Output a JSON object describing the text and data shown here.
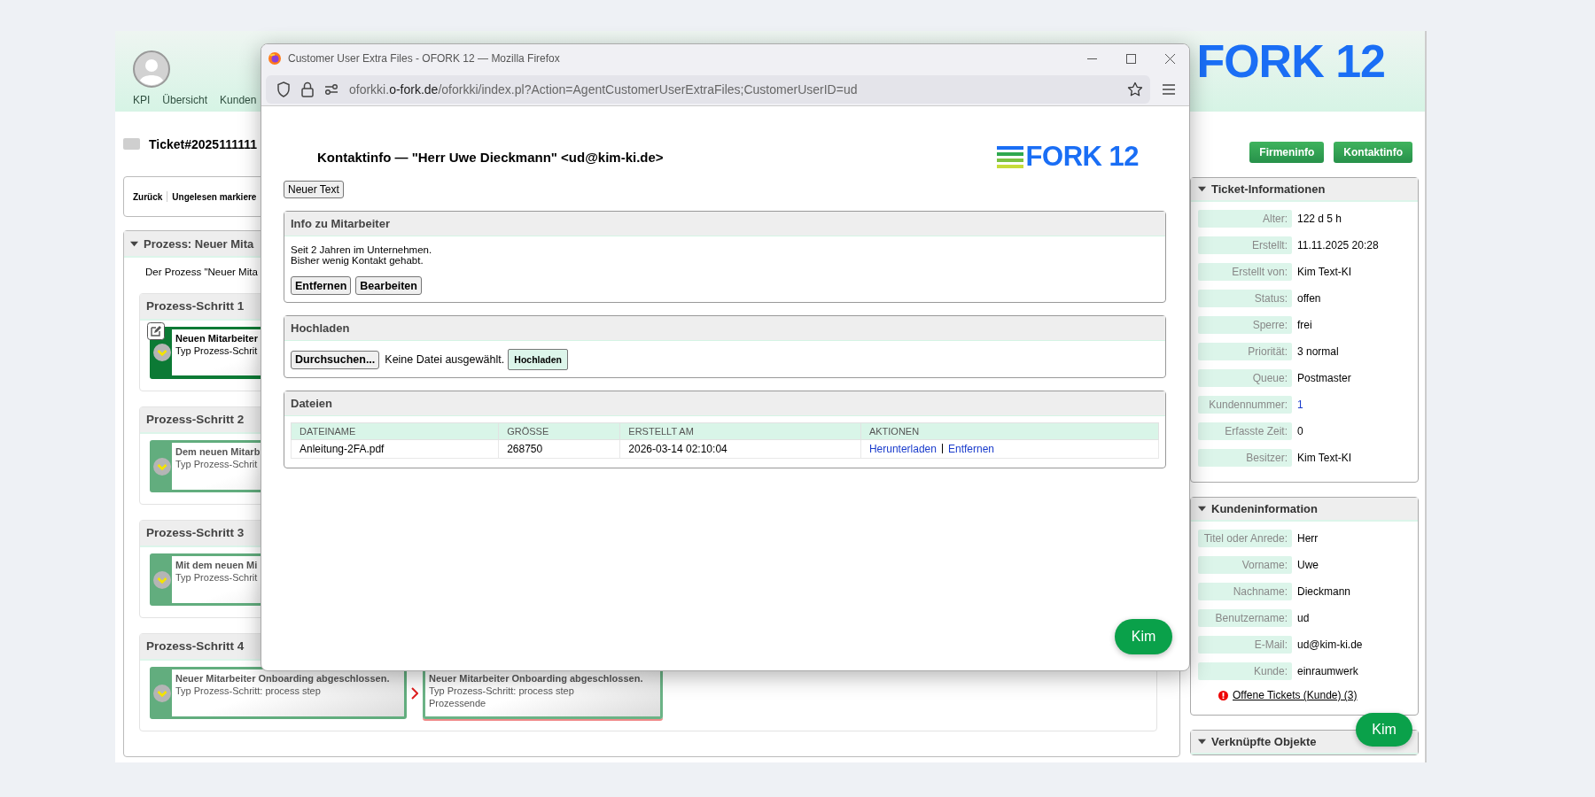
{
  "app": {
    "header": {
      "nav": [
        "KPI",
        "Übersicht",
        "Kunden"
      ],
      "logo": "FORK 12"
    },
    "ticket": {
      "title": "Ticket#2025111111"
    },
    "toolbar": {
      "actions": [
        "Zurück",
        "Ungelesen markiere"
      ]
    },
    "process": {
      "title": "Prozess: Neuer Mita",
      "expanded": true,
      "description": "Der Prozess \"Neuer Mita",
      "steps": [
        {
          "title": "Prozess-Schritt 1",
          "cards": [
            {
              "kind": "step",
              "active": true,
              "lines": [
                "Neuen Mitarbeiter",
                "Typ Prozess-Schrit"
              ]
            }
          ]
        },
        {
          "title": "Prozess-Schritt 2",
          "cards": [
            {
              "kind": "step",
              "active": false,
              "lines": [
                "Dem neuen Mitarb",
                "Typ Prozess-Schrit"
              ]
            }
          ]
        },
        {
          "title": "Prozess-Schritt 3",
          "cards": [
            {
              "kind": "step",
              "active": false,
              "lines": [
                "Mit dem neuen Mi",
                "Typ Prozess-Schrit"
              ]
            }
          ]
        },
        {
          "title": "Prozess-Schritt 4",
          "cards": [
            {
              "kind": "step",
              "active": false,
              "lines": [
                "Neuer Mitarbeiter Onboarding abgeschlossen.",
                "Typ Prozess-Schritt: process step"
              ]
            },
            {
              "kind": "end",
              "active": false,
              "lines": [
                "Neuer Mitarbeiter Onboarding abgeschlossen.",
                "Typ Prozess-Schritt: process step",
                "Prozessende"
              ]
            }
          ]
        }
      ]
    },
    "sidebar": {
      "buttons": [
        "Firmeninfo",
        "Kontaktinfo"
      ],
      "boxes": [
        {
          "title": "Ticket-Informationen",
          "expanded": true,
          "rows": [
            {
              "label": "Alter:",
              "value": "122 d 5 h",
              "kind": "text"
            },
            {
              "label": "Erstellt:",
              "value": "11.11.2025 20:28",
              "kind": "text"
            },
            {
              "label": "Erstellt von:",
              "value": "Kim Text-KI",
              "kind": "text"
            },
            {
              "label": "Status:",
              "value": "offen",
              "kind": "text"
            },
            {
              "label": "Sperre:",
              "value": "frei",
              "kind": "text"
            },
            {
              "label": "Priorität:",
              "value": "3 normal",
              "kind": "text"
            },
            {
              "label": "Queue:",
              "value": "Postmaster",
              "kind": "text"
            },
            {
              "label": "Kundennummer:",
              "value": "1",
              "kind": "link"
            },
            {
              "label": "Erfasste Zeit:",
              "value": "0",
              "kind": "text"
            },
            {
              "label": "Besitzer:",
              "value": "Kim Text-KI",
              "kind": "text"
            }
          ]
        },
        {
          "title": "Kundeninformation",
          "expanded": true,
          "rows": [
            {
              "label": "Titel oder Anrede:",
              "value": "Herr",
              "kind": "text"
            },
            {
              "label": "Vorname:",
              "value": "Uwe",
              "kind": "text"
            },
            {
              "label": "Nachname:",
              "value": "Dieckmann",
              "kind": "text"
            },
            {
              "label": "Benutzername:",
              "value": "ud",
              "kind": "text"
            },
            {
              "label": "E-Mail:",
              "value": "ud@kim-ki.de",
              "kind": "text"
            },
            {
              "label": "Kunde:",
              "value": "einraumwerk",
              "kind": "text"
            }
          ],
          "link": "Offene Tickets (Kunde) (3)"
        },
        {
          "title": "Verknüpfte Objekte",
          "expanded": true
        }
      ]
    },
    "chat_button": "Kim"
  },
  "popup": {
    "title": "Customer User Extra Files - OFORK 12 — Mozilla Firefox",
    "url": {
      "prefix": "oforkki.",
      "domain": "o-fork.de",
      "path": "/oforkki/index.pl?Action=AgentCustomerUserExtraFiles;CustomerUserID=ud"
    },
    "heading": "Kontaktinfo — \"Herr Uwe Dieckmann\" <ud@kim-ki.de>",
    "logo": "FORK 12",
    "new_text_button": "Neuer Text",
    "info": {
      "title": "Info zu Mitarbeiter",
      "lines": [
        "Seit 2 Jahren im Unternehmen.",
        "Bisher wenig Kontakt gehabt."
      ],
      "buttons": [
        "Entfernen",
        "Bearbeiten"
      ]
    },
    "upload": {
      "title": "Hochladen",
      "browse": "Durchsuchen...",
      "no_file": "Keine Datei ausgewählt.",
      "submit": "Hochladen"
    },
    "files": {
      "title": "Dateien",
      "columns": [
        "DATEINAME",
        "GRÖSSE",
        "ERSTELLT AM",
        "AKTIONEN"
      ],
      "rows": [
        {
          "name": "Anleitung-2FA.pdf",
          "size": "268750",
          "created": "2026-03-14 02:10:04",
          "actions": [
            "Herunterladen",
            "Entfernen"
          ]
        }
      ]
    },
    "chat_button": "Kim"
  }
}
